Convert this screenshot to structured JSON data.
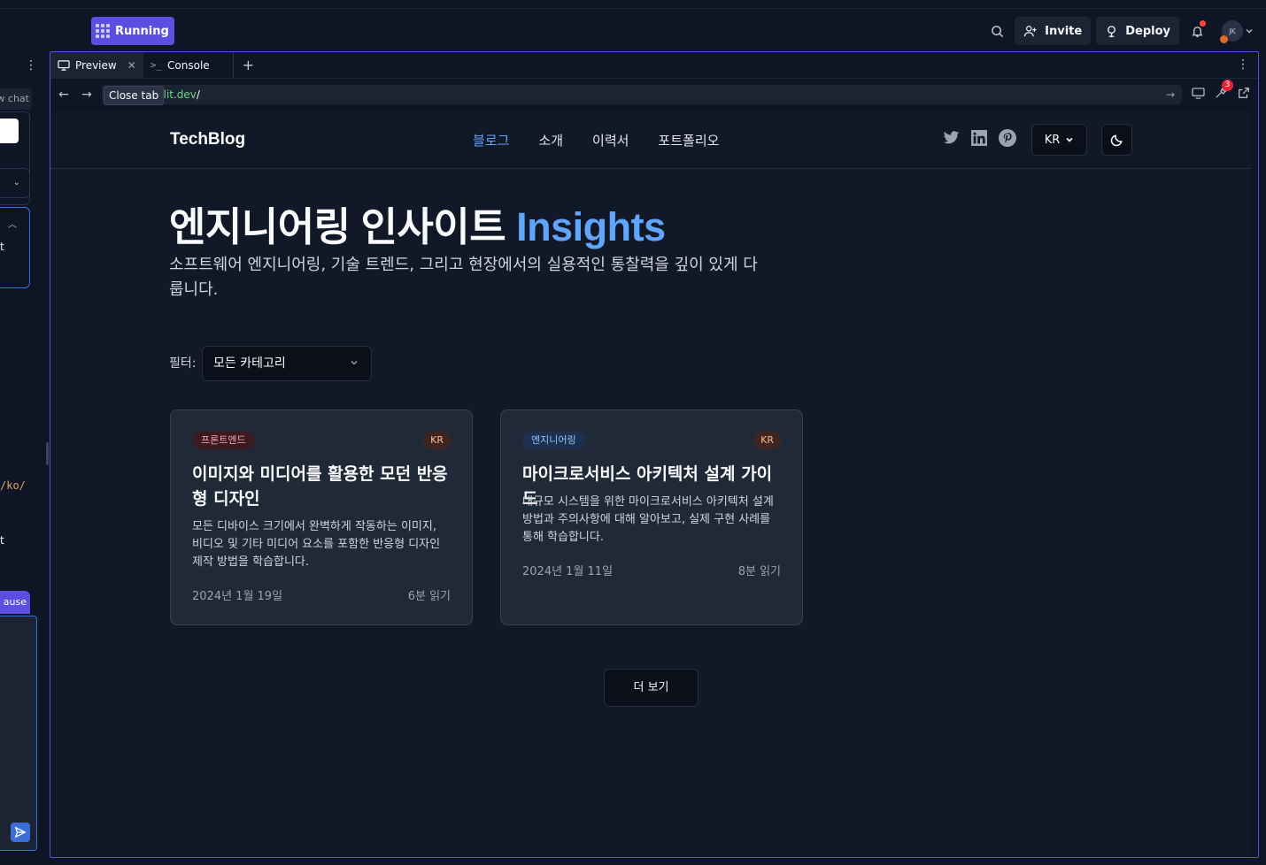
{
  "topbar": {
    "run_label": "Running",
    "invite_label": "Invite",
    "deploy_label": "Deploy",
    "avatar_initials": "JK"
  },
  "left_panel": {
    "chat_label": "w chat",
    "t1": "t",
    "ko_path": "/ko/",
    "t2": "t",
    "pause_label": "ause"
  },
  "tabs": [
    {
      "label": "Preview"
    },
    {
      "label": "Console"
    }
  ],
  "url": {
    "value": "plit.dev",
    "slash": "/",
    "tooltip": "Close tab",
    "badge_count": "3"
  },
  "site": {
    "logo": "TechBlog",
    "nav": [
      "블로그",
      "소개",
      "이력서",
      "포트폴리오"
    ],
    "lang": "KR",
    "hero_title": "엔지니어링 인사이트 ",
    "hero_accent": "Insights",
    "hero_sub": "소프트웨어 엔지니어링, 기술 트렌드, 그리고 현장에서의 실용적인 통찰력을 깊이 있게 다룹니다.",
    "filter_label": "필터:",
    "filter_value": "모든 카테고리",
    "posts": [
      {
        "category": "프론트엔드",
        "lang": "KR",
        "title": "이미지와 미디어를 활용한 모던 반응형 디자인",
        "description": "모든 디바이스 크기에서 완벽하게 작동하는 이미지, 비디오 및 기타 미디어 요소를 포함한 반응형 디자인 제작 방법을 학습합니다.",
        "date": "2024년 1월 19일",
        "read_time": "6분 읽기"
      },
      {
        "category": "엔지니어링",
        "lang": "KR",
        "title": "마이크로서비스 아키텍처 설계 가이드",
        "description": "대규모 시스템을 위한 마이크로서비스 아키텍처 설계 방법과 주의사항에 대해 알아보고, 실제 구현 사례를 통해 학습합니다.",
        "date": "2024년 1월 11일",
        "read_time": "8분 읽기"
      }
    ],
    "more_label": "더 보기"
  }
}
